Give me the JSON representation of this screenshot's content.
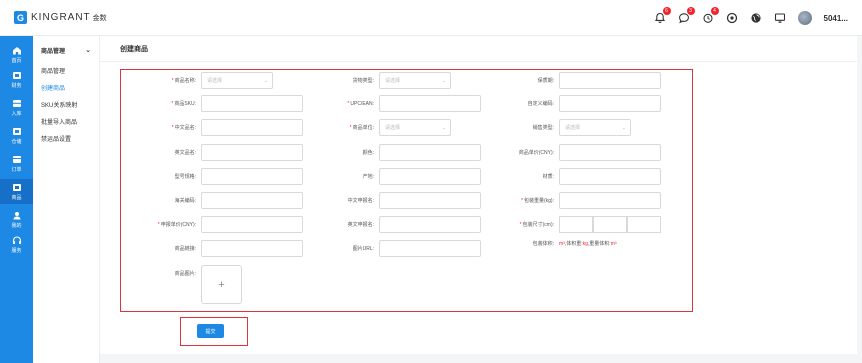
{
  "app": {
    "logo_mark": "G",
    "logo_text": "KINGRANT",
    "logo_cn": "金数",
    "username": "5041...",
    "badges": [
      "6",
      "3",
      "4"
    ]
  },
  "rail": {
    "items": [
      {
        "label": "首页",
        "icon": "home-icon"
      },
      {
        "label": "财务",
        "icon": "finance-icon"
      },
      {
        "label": "入库",
        "icon": "inbound-icon"
      },
      {
        "label": "仓储",
        "icon": "warehouse-icon"
      },
      {
        "label": "订单",
        "icon": "order-icon"
      },
      {
        "label": "商品",
        "icon": "goods-icon"
      },
      {
        "label": "我的",
        "icon": "user-icon"
      },
      {
        "label": "服务",
        "icon": "headset-icon"
      }
    ]
  },
  "submenu": {
    "header": "商品管理",
    "items": [
      "商品管理",
      "创建商品",
      "SKU关系映射",
      "批量导入商品",
      "禁运品设置"
    ]
  },
  "page": {
    "title": "创建商品",
    "submit": "提交"
  },
  "form": {
    "product_name": {
      "label": "商品名称:",
      "placeholder": "请选择"
    },
    "cargo_type": {
      "label": "货物类型:",
      "placeholder": "请选择"
    },
    "reserve": {
      "label": "保质期:"
    },
    "sku": {
      "label": "商品SKU:"
    },
    "upc": {
      "label": "UPC/EAN:"
    },
    "custom_code": {
      "label": "自定义编码:"
    },
    "cn_name": {
      "label": "中文品名:"
    },
    "unit": {
      "label": "商品单位:",
      "placeholder": "请选择"
    },
    "sale_type": {
      "label": "销售类型:",
      "placeholder": "请选择"
    },
    "en_name": {
      "label": "英文品名:"
    },
    "color": {
      "label": "颜色:"
    },
    "price": {
      "label": "商品单价(CNY):"
    },
    "model": {
      "label": "型号规格:"
    },
    "origin": {
      "label": "产地:"
    },
    "material": {
      "label": "材质:"
    },
    "brand": {
      "label": "海关编码:"
    },
    "cn_customs": {
      "label": "中文申报名:"
    },
    "weight": {
      "label": "包装重量(kg):"
    },
    "declare_price": {
      "label": "申报单价(CNY):"
    },
    "en_customs": {
      "label": "英文申报名:"
    },
    "size": {
      "label": "包装尺寸(cm):"
    },
    "link": {
      "label": "商品链接:"
    },
    "image_url": {
      "label": "图片URL:"
    },
    "volume": {
      "label": "包装体积:",
      "unit1": "m³",
      "mid": ",体积重:",
      "unit2": "kg",
      "mid2": ",重量体积:",
      "unit3": "m³"
    },
    "images": {
      "label": "商品图片:",
      "plus": "+"
    }
  }
}
